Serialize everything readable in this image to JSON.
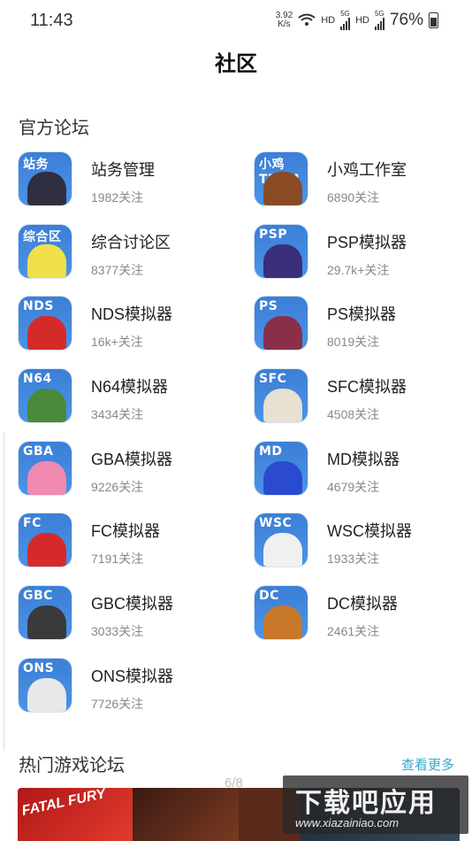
{
  "status_bar": {
    "time": "11:43",
    "speed_value": "3.92",
    "speed_unit": "K/s",
    "hd1": "HD",
    "net1": "5G",
    "hd2": "HD",
    "net2": "5G",
    "battery": "76%"
  },
  "page": {
    "title": "社区"
  },
  "official_section": {
    "title": "官方论坛"
  },
  "forums": [
    {
      "name": "站务管理",
      "followers": "1982关注",
      "tag": "站务",
      "color": "#2f2f3f"
    },
    {
      "name": "小鸡工作室",
      "followers": "6890关注",
      "tag": "小鸡TEAM",
      "color": "#8a4a24"
    },
    {
      "name": "综合讨论区",
      "followers": "8377关注",
      "tag": "综合区",
      "color": "#f2e04a"
    },
    {
      "name": "PSP模拟器",
      "followers": "29.7k+关注",
      "tag": "PSP",
      "color": "#3b2f7a"
    },
    {
      "name": "NDS模拟器",
      "followers": "16k+关注",
      "tag": "NDS",
      "color": "#d62a2a"
    },
    {
      "name": "PS模拟器",
      "followers": "8019关注",
      "tag": "PS",
      "color": "#8a2f4a"
    },
    {
      "name": "N64模拟器",
      "followers": "3434关注",
      "tag": "N64",
      "color": "#4a8a3a"
    },
    {
      "name": "SFC模拟器",
      "followers": "4508关注",
      "tag": "SFC",
      "color": "#e8e0d0"
    },
    {
      "name": "GBA模拟器",
      "followers": "9226关注",
      "tag": "GBA",
      "color": "#f08ab0"
    },
    {
      "name": "MD模拟器",
      "followers": "4679关注",
      "tag": "MD",
      "color": "#2a4ad0"
    },
    {
      "name": "FC模拟器",
      "followers": "7191关注",
      "tag": "FC",
      "color": "#d62a2a"
    },
    {
      "name": "WSC模拟器",
      "followers": "1933关注",
      "tag": "WSC",
      "color": "#f0f0f0"
    },
    {
      "name": "GBC模拟器",
      "followers": "3033关注",
      "tag": "GBC",
      "color": "#3a3a3a"
    },
    {
      "name": "DC模拟器",
      "followers": "2461关注",
      "tag": "DC",
      "color": "#c8782a"
    },
    {
      "name": "ONS模拟器",
      "followers": "7726关注",
      "tag": "ONS",
      "color": "#e8e8e8"
    }
  ],
  "hot_section": {
    "title": "热门游戏论坛",
    "view_more": "查看更多"
  },
  "banner": {
    "logo_text": "FATAL FURY",
    "pager": "6/8"
  },
  "watermark": {
    "main": "下载吧应用",
    "url": "www.xiazainiao.com"
  }
}
